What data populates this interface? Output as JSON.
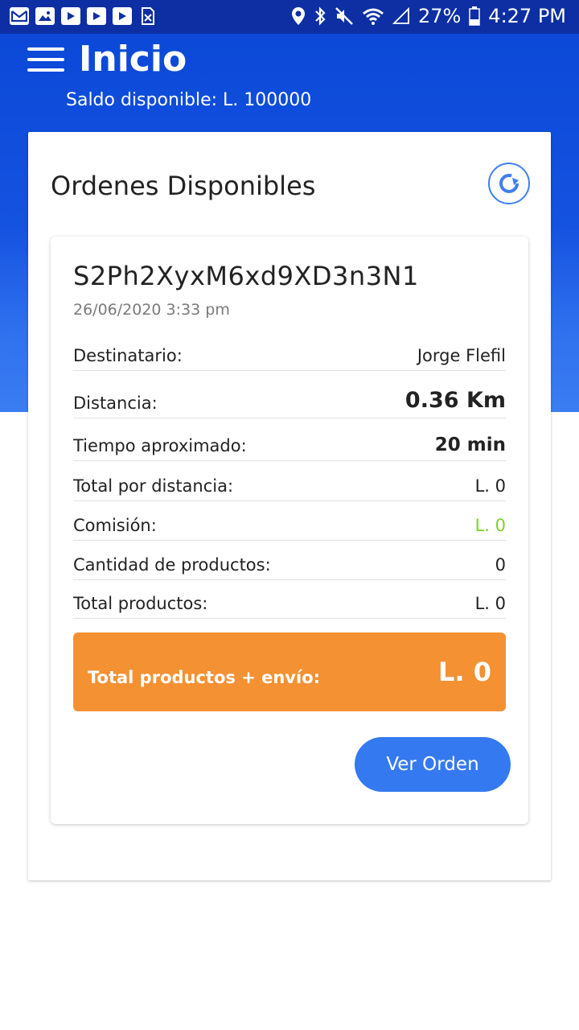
{
  "status_bar": {
    "battery": "27%",
    "time": "4:27 PM",
    "left_icons": [
      "gmail-icon",
      "gallery-icon",
      "youtube-icon",
      "youtube-icon",
      "youtube-icon",
      "sim-icon"
    ],
    "right_icons": [
      "location-icon",
      "bluetooth-icon",
      "mute-icon",
      "wifi-icon",
      "signal-icon",
      "battery-icon"
    ]
  },
  "header": {
    "title": "Inicio",
    "balance": "Saldo disponible: L. 100000",
    "menu_icon": "hamburger-menu-icon"
  },
  "panel": {
    "title": "Ordenes Disponibles",
    "refresh_icon": "refresh-icon"
  },
  "order": {
    "id": "S2Ph2XyxM6xd9XD3n3N1",
    "date": "26/06/2020 3:33 pm",
    "rows": [
      {
        "label": "Destinatario:",
        "value": "Jorge Flefil"
      },
      {
        "label": "Distancia:",
        "value": "0.36 Km"
      },
      {
        "label": "Tiempo aproximado:",
        "value": "20 min"
      },
      {
        "label": "Total por distancia:",
        "value": "L. 0"
      },
      {
        "label": "Comisión:",
        "value": "L. 0"
      },
      {
        "label": "Cantidad de productos:",
        "value": "0"
      },
      {
        "label": "Total productos:",
        "value": "L. 0"
      }
    ],
    "total_label": "Total productos + envío:",
    "total_value": "L. 0",
    "button_label": "Ver Orden"
  },
  "colors": {
    "header_blue": "#0a47d6",
    "status_bar": "#0d2fa3",
    "accent_blue": "#3479f0",
    "orange": "#f39133",
    "green": "#7ed321"
  }
}
